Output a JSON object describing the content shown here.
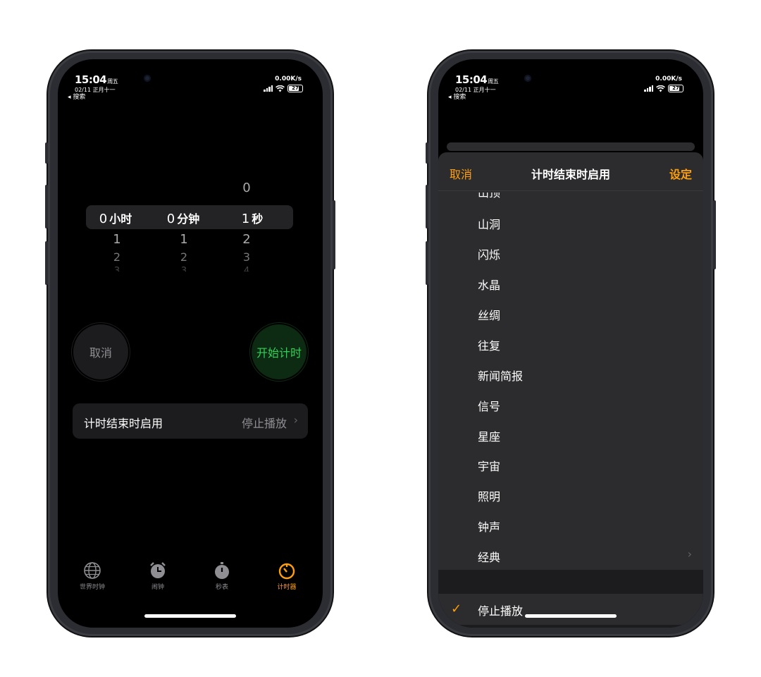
{
  "status": {
    "time": "15:04",
    "weekday": "周五",
    "date": "02/11 正月十一",
    "back": "◂ 搜索",
    "speed": "0.00K/s",
    "battery": "27"
  },
  "left": {
    "picker": {
      "above_sec": "0",
      "hours_value": "0",
      "hours_unit": "小时",
      "minutes_value": "0",
      "minutes_unit": "分钟",
      "seconds_value": "1",
      "seconds_unit": "秒",
      "hours_below": [
        "1",
        "2",
        "3"
      ],
      "minutes_below": [
        "1",
        "2",
        "3"
      ],
      "seconds_below": [
        "2",
        "3",
        "4"
      ]
    },
    "cancel_label": "取消",
    "start_label": "开始计时",
    "when_ends": {
      "label": "计时结束时启用",
      "value": "停止播放",
      "chevron": "›"
    },
    "tabs": [
      {
        "label": "世界时钟",
        "icon": "globe-icon"
      },
      {
        "label": "闹钟",
        "icon": "alarm-clock-icon"
      },
      {
        "label": "秒表",
        "icon": "stopwatch-icon"
      },
      {
        "label": "计时器",
        "icon": "timer-icon",
        "active": true
      }
    ]
  },
  "right": {
    "header": {
      "cancel": "取消",
      "title": "计时结束时启用",
      "set": "设定"
    },
    "tones_partial": "山顶",
    "tones": [
      "山洞",
      "闪烁",
      "水晶",
      "丝绸",
      "往复",
      "新闻简报",
      "信号",
      "星座",
      "宇宙",
      "照明",
      "钟声",
      "经典"
    ],
    "classic_chevron": "›",
    "stop": {
      "check": "✓",
      "label": "停止播放"
    }
  },
  "colors": {
    "accent": "#ff9f0a",
    "start_green": "#30d158"
  }
}
